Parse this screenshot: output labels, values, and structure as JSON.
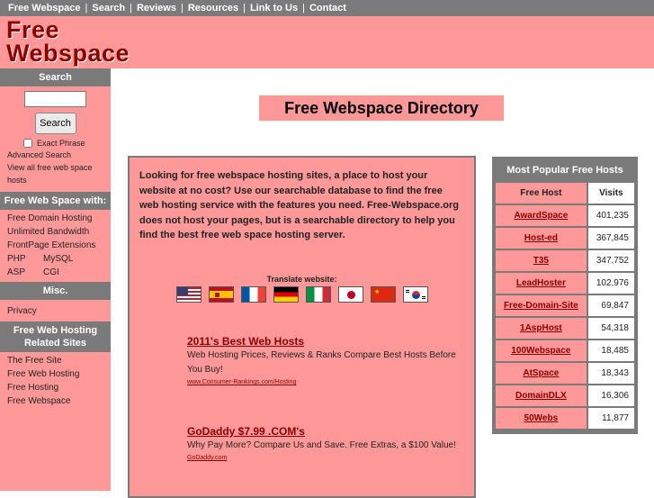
{
  "topnav": {
    "items": [
      "Free Webspace",
      "Search",
      "Reviews",
      "Resources",
      "Link to Us",
      "Contact"
    ],
    "separator": "|"
  },
  "logo": {
    "line1": "Free",
    "line2": "Webspace"
  },
  "sidebar": {
    "search_heading": "Search",
    "search_input_value": "",
    "search_button": "Search",
    "exact_phrase_label": "Exact Phrase",
    "advanced_search": "Advanced Search",
    "view_all": "View all free web space hosts",
    "features_heading": "Free Web Space with:",
    "features": [
      "Free Domain Hosting",
      "Unlimited Bandwidth",
      "FrontPage Extensions"
    ],
    "features_pairs": [
      [
        "PHP",
        "MySQL"
      ],
      [
        "ASP",
        "CGI"
      ]
    ],
    "misc_heading": "Misc.",
    "misc": [
      "Privacy"
    ],
    "related_heading": "Free Web Hosting Related Sites",
    "related": [
      "The Free Site",
      "Free Web Hosting",
      "Free Hosting",
      "Free Webspace"
    ]
  },
  "main": {
    "title": "Free Webspace Directory",
    "intro": "Looking for free webspace hosting sites, a place to host your website at no cost?  Use our searchable database to find the free web hosting service with the features you need.  Free-Webspace.org does not host your pages, but is a searchable directory to help you find the best free web space hosting server.",
    "translate_label": "Translate website:",
    "flags": [
      "us-flag-icon",
      "spain-flag-icon",
      "france-flag-icon",
      "germany-flag-icon",
      "italy-flag-icon",
      "japan-flag-icon",
      "china-flag-icon",
      "korea-flag-icon"
    ],
    "ads": [
      {
        "title": "2011's Best Web Hosts",
        "body": "Web Hosting Prices, Reviews & Ranks Compare Best Hosts Before You Buy!",
        "url": "www.Consumer-Rankings.com/Hosting"
      },
      {
        "title": "GoDaddy $7.99 .COM's",
        "body": "Why Pay More? Compare Us and Save. Free Extras, a $100 Value!",
        "url": "GoDaddy.com"
      }
    ]
  },
  "popular": {
    "heading": "Most Popular Free Hosts",
    "col_host": "Free Host",
    "col_visits": "Visits",
    "rows": [
      {
        "host": "AwardSpace",
        "visits": "401,235"
      },
      {
        "host": "Host-ed",
        "visits": "367,845"
      },
      {
        "host": "T35",
        "visits": "347,752"
      },
      {
        "host": "LeadHoster",
        "visits": "102,976"
      },
      {
        "host": "Free-Domain-Site",
        "visits": "69,847"
      },
      {
        "host": "1AspHost",
        "visits": "54,318"
      },
      {
        "host": "100Webspace",
        "visits": "18,485"
      },
      {
        "host": "AtSpace",
        "visits": "18,343"
      },
      {
        "host": "DomainDLX",
        "visits": "16,306"
      },
      {
        "host": "50Webs",
        "visits": "11,877"
      }
    ]
  },
  "colors": {
    "brand": "#ff9999",
    "brand_dark": "#8b0000",
    "nav_gray": "#7a7a7a"
  }
}
